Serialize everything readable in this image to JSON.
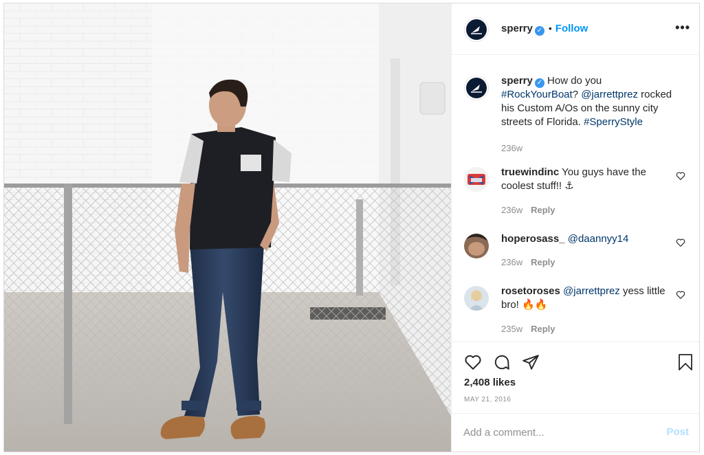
{
  "post": {
    "author": "sperry",
    "follow_label": "Follow",
    "more_label": "•••",
    "verified_mark": "✓",
    "dot": "•"
  },
  "caption": {
    "username": "sperry",
    "text_1": " How do you ",
    "tag_rockyourboat": "#RockYourBoat",
    "text_2": "? ",
    "mention_jarrett": "@jarrettprez",
    "text_3": " rocked his Custom A/Os on the sunny city streets of Florida. ",
    "tag_sperrystyle": "#SperryStyle",
    "time": "236w"
  },
  "comments": [
    {
      "username": "truewindinc",
      "text": " You guys have the coolest stuff!! ⚓",
      "time": "236w",
      "reply": "Reply"
    },
    {
      "username": "hoperosass_",
      "mention": "@daannyy14",
      "time": "236w",
      "reply": "Reply"
    },
    {
      "username": "rosetoroses",
      "mention": "@jarrettprez",
      "text": " yess little bro! 🔥🔥",
      "time": "235w",
      "reply": "Reply"
    }
  ],
  "actions": {
    "likes": "2,408 likes",
    "date": "MAY 21, 2016"
  },
  "add_comment": {
    "placeholder": "Add a comment...",
    "post_label": "Post"
  },
  "colors": {
    "link": "#00376b",
    "follow": "#0095f6",
    "post_disabled": "#b2dffc",
    "verified": "#3897f0"
  },
  "icons": [
    "more-options-icon",
    "verified-badge-icon",
    "heart-icon",
    "comment-icon",
    "share-icon",
    "bookmark-icon"
  ]
}
